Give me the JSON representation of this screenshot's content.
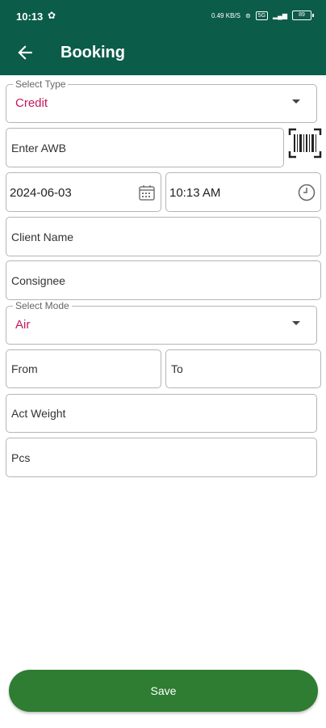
{
  "status_bar": {
    "time": "10:13",
    "net_speed": "0.49 KB/S",
    "sim": "5G",
    "battery": "89"
  },
  "app_bar": {
    "title": "Booking"
  },
  "form": {
    "type_select": {
      "label": "Select Type",
      "value": "Credit"
    },
    "awb_field": {
      "placeholder": "Enter AWB"
    },
    "date_field": {
      "value": "2024-06-03"
    },
    "time_field": {
      "value": "10:13 AM"
    },
    "client_name_field": {
      "placeholder": "Client Name"
    },
    "consignee_field": {
      "placeholder": "Consignee"
    },
    "mode_select": {
      "label": "Select Mode",
      "value": "Air"
    },
    "from_field": {
      "placeholder": "From"
    },
    "to_field": {
      "placeholder": "To"
    },
    "act_weight_field": {
      "placeholder": "Act Weight"
    },
    "pcs_field": {
      "placeholder": "Pcs"
    }
  },
  "actions": {
    "save_label": "Save"
  },
  "colors": {
    "header": "#0b5c48",
    "save_button": "#2e7d32",
    "select_value": "#c2185b"
  },
  "icons": [
    "back-arrow-icon",
    "barcode-scanner-icon",
    "calendar-icon",
    "clock-icon",
    "dropdown-arrow-icon"
  ]
}
